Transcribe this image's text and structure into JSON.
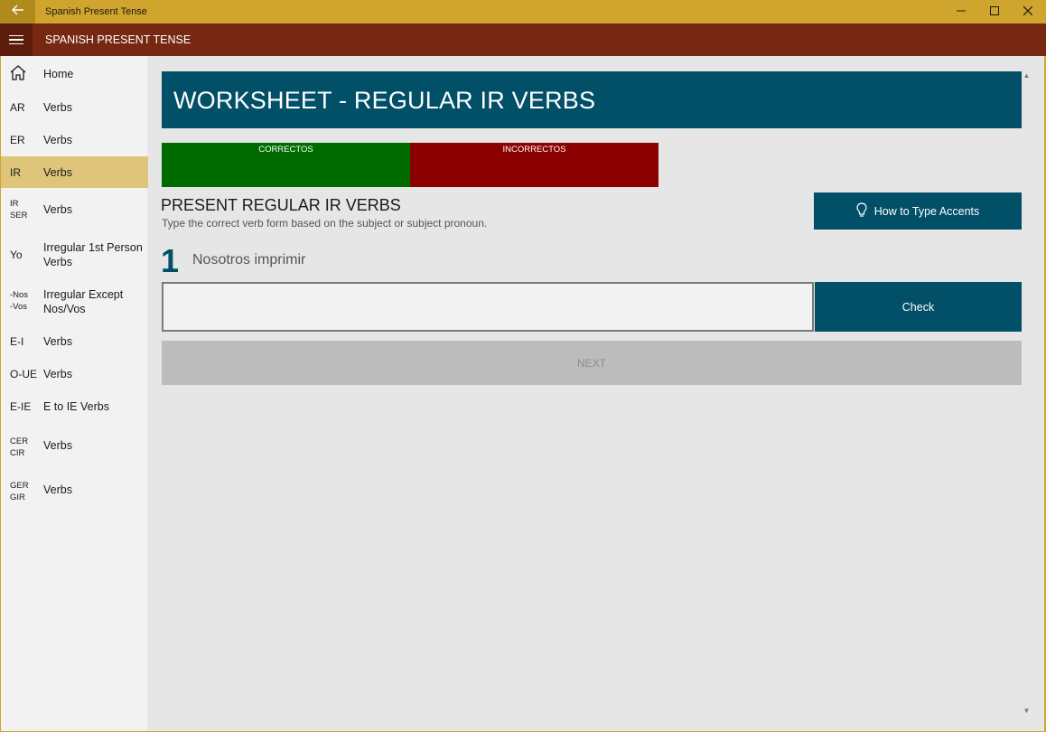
{
  "window": {
    "title": "Spanish Present Tense",
    "controls": {
      "minimize": "—",
      "maximize": "☐",
      "close": "✕"
    }
  },
  "appbar": {
    "title": "SPANISH PRESENT TENSE"
  },
  "sidebar": {
    "items": [
      {
        "abbr": "",
        "label": "Home",
        "icon": "home-icon"
      },
      {
        "abbr": "AR",
        "label": "Verbs"
      },
      {
        "abbr": "ER",
        "label": "Verbs"
      },
      {
        "abbr": "IR",
        "label": "Verbs",
        "selected": true
      },
      {
        "abbr1": "IR",
        "abbr2": "SER",
        "label": "Verbs"
      },
      {
        "abbr": "Yo",
        "label1": "Irregular 1st Person",
        "label2": "Verbs"
      },
      {
        "abbr1": "-Nos",
        "abbr2": "-Vos",
        "label1": "Irregular Except",
        "label2": "Nos/Vos"
      },
      {
        "abbr": "E-I",
        "label": "Verbs"
      },
      {
        "abbr": "O-UE",
        "label": "Verbs"
      },
      {
        "abbr": "E-IE",
        "label": "E to IE Verbs"
      },
      {
        "abbr1": "CER",
        "abbr2": "CIR",
        "label": "Verbs"
      },
      {
        "abbr1": "GER",
        "abbr2": "GIR",
        "label": "Verbs"
      }
    ]
  },
  "main": {
    "header": "WORKSHEET - REGULAR IR VERBS",
    "score": {
      "correct_label": "CORRECTOS",
      "incorrect_label": "INCORRECTOS"
    },
    "section_title": "PRESENT REGULAR IR VERBS",
    "section_subtitle": "Type the correct verb form based on the subject or subject pronoun.",
    "accent_button": "How to Type Accents",
    "question_number": "1",
    "question_text": "Nosotros imprimir",
    "answer_value": "",
    "check_button": "Check",
    "next_button": "NEXT"
  },
  "colors": {
    "titlebar": "#d0a52d",
    "appbar": "#762812",
    "accent": "#024f68",
    "correct": "#006c00",
    "incorrect": "#8b0000",
    "selected": "#dec57a"
  }
}
